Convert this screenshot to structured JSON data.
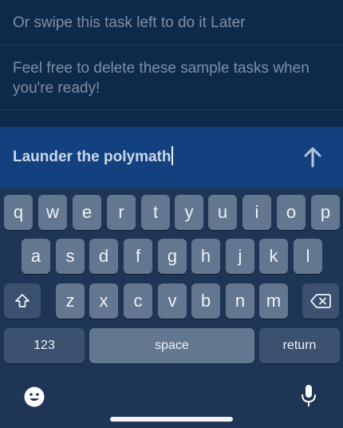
{
  "tasks": [
    {
      "text": "Or swipe this task left to do it Later"
    },
    {
      "text": "Feel free to delete these sample tasks when you're ready!"
    }
  ],
  "composer": {
    "value": "Launder the polymath"
  },
  "keyboard": {
    "row1": [
      "q",
      "w",
      "e",
      "r",
      "t",
      "y",
      "u",
      "i",
      "o",
      "p"
    ],
    "row2": [
      "a",
      "s",
      "d",
      "f",
      "g",
      "h",
      "j",
      "k",
      "l"
    ],
    "row3": [
      "z",
      "x",
      "c",
      "v",
      "b",
      "n",
      "m"
    ],
    "numbers_label": "123",
    "space_label": "space",
    "return_label": "return"
  },
  "icons": {
    "send": "arrow-up-icon",
    "shift": "shift-icon",
    "delete": "delete-backward-icon",
    "emoji": "emoji-icon",
    "mic": "microphone-icon"
  },
  "colors": {
    "background": "#0e2a4a",
    "composer": "#13417f",
    "keyboard": "#1e3555",
    "key": "#647790",
    "special_key": "#3b516f"
  }
}
